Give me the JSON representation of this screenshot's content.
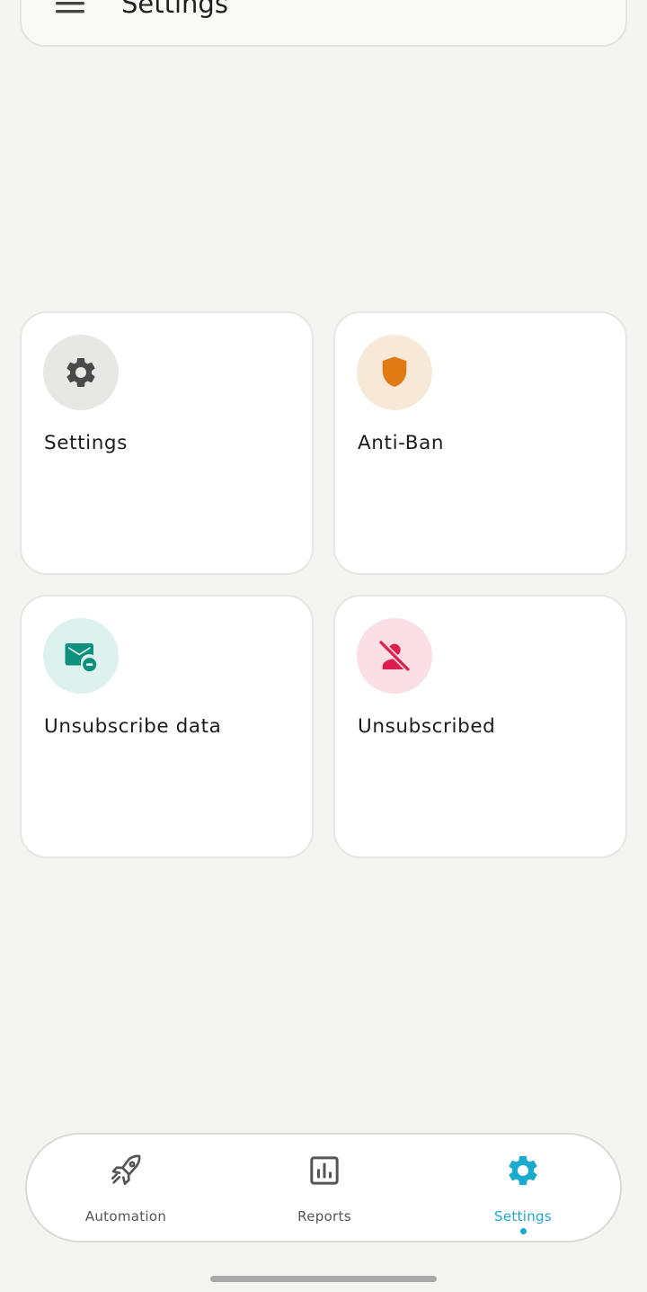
{
  "header": {
    "title": "Settings",
    "menu_icon": "menu-icon"
  },
  "cards": [
    {
      "label": "Settings",
      "icon": "gear-icon",
      "icon_color": "#4a4a4a",
      "icon_bg": "#e7e7e6"
    },
    {
      "label": "Anti-Ban",
      "icon": "shield-icon",
      "icon_color": "#e07a12",
      "icon_bg": "#f8e8d8"
    },
    {
      "label": "Unsubscribe data",
      "icon": "mail-remove-icon",
      "icon_color": "#0f8f7e",
      "icon_bg": "#ddf1ee"
    },
    {
      "label": "Unsubscribed",
      "icon": "person-off-icon",
      "icon_color": "#e01e4e",
      "icon_bg": "#fbdfe4"
    }
  ],
  "bottom_nav": {
    "items": [
      {
        "label": "Automation",
        "icon": "rocket-icon",
        "active": false
      },
      {
        "label": "Reports",
        "icon": "bar-chart-icon",
        "active": false
      },
      {
        "label": "Settings",
        "icon": "gear-icon",
        "active": true
      }
    ],
    "active_color": "#1aa9cf",
    "inactive_color": "#555555"
  }
}
